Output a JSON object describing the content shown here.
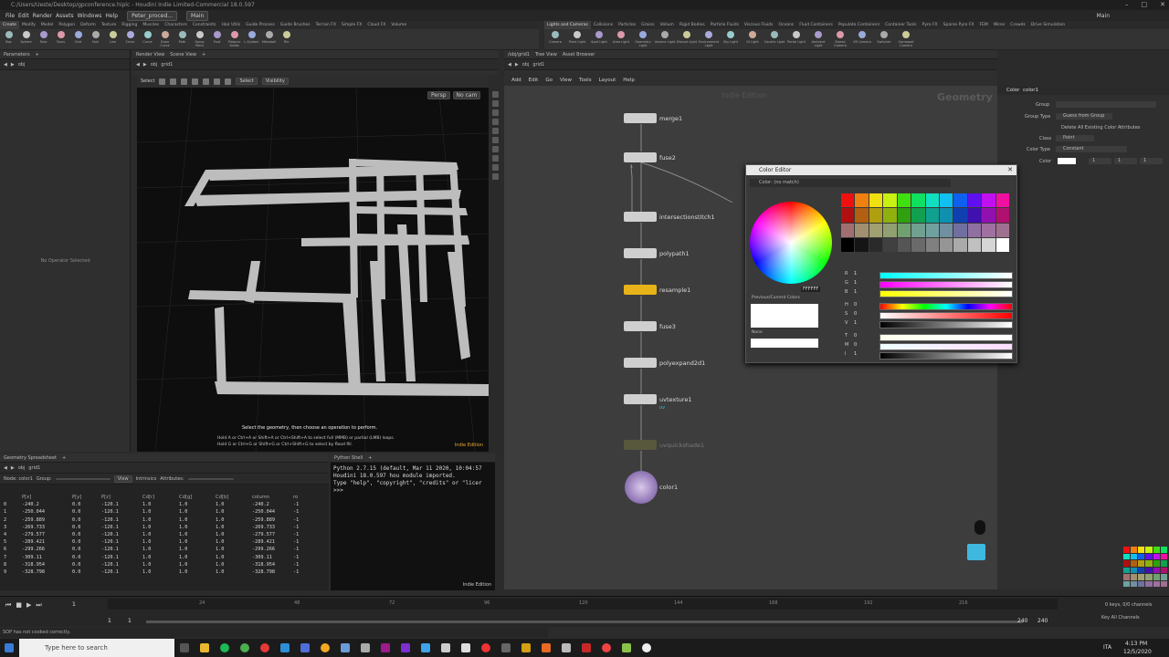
{
  "window": {
    "title": "C:/Users/Ueste/Desktop/gpconference.hiplc - Houdini Indie Limited-Commercial 18.0.597",
    "menus": [
      "File",
      "Edit",
      "Render",
      "Assets",
      "Windows",
      "Help"
    ],
    "desk": "Peter_proced...",
    "desk_main": "Main",
    "right_desk": "Main"
  },
  "shelf_left": {
    "tabs": [
      "Create",
      "Modify",
      "Model",
      "Polygon",
      "Deform",
      "Texture",
      "Rigging",
      "Muscles",
      "Characters",
      "Constraints",
      "Hair Utils",
      "Guide Process",
      "Guide Brushes",
      "Terrain FX",
      "Simple FX",
      "Cloud FX",
      "Volume"
    ],
    "tools": [
      "Box",
      "Sphere",
      "Tube",
      "Torus",
      "Grid",
      "Null",
      "Line",
      "Circle",
      "Curve",
      "Draw Curve",
      "Path",
      "Spray Paint",
      "Font",
      "Platonic Solids",
      "L-System",
      "Metaball",
      "File"
    ]
  },
  "shelf_right": {
    "tabs": [
      "Lights and Cameras",
      "Collisions",
      "Particles",
      "Grains",
      "Vellum",
      "Rigid Bodies",
      "Particle Fluids",
      "Viscous Fluids",
      "Oceans",
      "Fluid Containers",
      "Populate Containers",
      "Container Tools",
      "Pyro FX",
      "Sparse Pyro FX",
      "FEM",
      "Wires",
      "Crowds",
      "Drive Simulation"
    ],
    "tools": [
      "Camera",
      "Point Light",
      "Spot Light",
      "Area Light",
      "Geometry Light",
      "Volume Light",
      "Distant Light",
      "Environment Light",
      "Sky Light",
      "GI Light",
      "Caustic Light",
      "Portal Light",
      "Ambient Light",
      "Stereo Camera",
      "VR Camera",
      "Switcher",
      "Gamepad Camera"
    ]
  },
  "params_left": {
    "tab": "Parameters",
    "path": "obj",
    "empty_text": "No Operator Selected"
  },
  "viewport": {
    "tabs": [
      "Render View",
      "Scene View"
    ],
    "path": [
      "obj",
      "grid1"
    ],
    "select_label": "Select",
    "select_mode": "Select",
    "visibility": "Visibility",
    "persp": "Persp",
    "cam": "No cam",
    "hint_main": "Select the geometry, then choose an operation to perform.",
    "hint_line1": "Hold A or Ctrl+A or Shift+A or Ctrl+Shift+A to select full (MMB) or partial (LMB) loops.",
    "hint_line2": "Hold G or Ctrl+G or Shift+G or Ctrl+Shift+G to select by flood fill.",
    "edition": "Indie Edition"
  },
  "network": {
    "path_tab": "/obj/grid1",
    "tabs": [
      "Tree View",
      "Asset Browser"
    ],
    "path": [
      "obj",
      "grid1"
    ],
    "menus": [
      "Add",
      "Edit",
      "Go",
      "View",
      "Tools",
      "Layout",
      "Help"
    ],
    "watermark": "Indie Edition",
    "context": "Geometry",
    "nodes": [
      {
        "name": "merge1",
        "flag": ""
      },
      {
        "name": "fuse2",
        "flag": ""
      },
      {
        "name": "intersectionstitch1",
        "flag": ""
      },
      {
        "name": "polypath1",
        "flag": ""
      },
      {
        "name": "resample1",
        "flag": ""
      },
      {
        "name": "fuse3",
        "flag": ""
      },
      {
        "name": "polyexpand2d1",
        "flag": ""
      },
      {
        "name": "uvtexture1",
        "flag": "uv"
      },
      {
        "name": "uvquickshade1",
        "flag": ""
      },
      {
        "name": "color1",
        "flag": ""
      }
    ]
  },
  "color_params": {
    "node_type": "Color",
    "node_name": "color1",
    "labels": {
      "group": "Group",
      "group_type": "Group Type",
      "group_type_val": "Guess from Group",
      "delete_attr": "Delete All Existing Color Attributes",
      "class": "Class",
      "class_val": "Point",
      "color_type": "Color Type",
      "color_type_val": "Constant",
      "color": "Color",
      "c1": "1",
      "c2": "1",
      "c3": "1"
    }
  },
  "color_editor": {
    "title": "Color Editor",
    "match": "Color: (no match)",
    "hex": "FFFFFF",
    "prev_current": "Previous/Current Colors",
    "none": "None",
    "channels": [
      {
        "l": "R",
        "v": "1"
      },
      {
        "l": "G",
        "v": "1"
      },
      {
        "l": "B",
        "v": "1"
      },
      {
        "l": "H",
        "v": "0"
      },
      {
        "l": "S",
        "v": "0"
      },
      {
        "l": "V",
        "v": "1"
      },
      {
        "l": "T",
        "v": "0"
      },
      {
        "l": "M",
        "v": "0"
      },
      {
        "l": "I",
        "v": "1"
      }
    ],
    "swatches": [
      "#f01010",
      "#f08010",
      "#f0e010",
      "#c8f010",
      "#40e010",
      "#10e060",
      "#10e0c0",
      "#10c0f0",
      "#1060f0",
      "#6010f0",
      "#c010f0",
      "#f010a0",
      "#b01010",
      "#b06010",
      "#b0a010",
      "#90b010",
      "#30a010",
      "#10a050",
      "#10a090",
      "#1090b0",
      "#1040b0",
      "#4010b0",
      "#9010b0",
      "#b01070",
      "#a07070",
      "#a09070",
      "#a0a070",
      "#90a070",
      "#70a070",
      "#70a090",
      "#70a0a0",
      "#7090a0",
      "#7070a0",
      "#9070a0",
      "#a070a0",
      "#a07090",
      "#000000",
      "#151515",
      "#2a2a2a",
      "#404040",
      "#555555",
      "#6a6a6a",
      "#808080",
      "#959595",
      "#aaaaaa",
      "#c0c0c0",
      "#d5d5d5",
      "#ffffff"
    ]
  },
  "spreadsheet": {
    "tab": "Geometry Spreadsheet",
    "path": [
      "obj",
      "grid1"
    ],
    "group_label": "Group:",
    "view": "View",
    "intrinsics": "Intrinsics",
    "attributes": "Attributes:",
    "node": "Node: color1",
    "headers": [
      "",
      "P[x]",
      "P[y]",
      "P[z]",
      "Cd[r]",
      "Cd[g]",
      "Cd[b]",
      "column",
      "ro"
    ],
    "rows": [
      [
        "0",
        "-240.2",
        "0.0",
        "-120.1",
        "1.0",
        "1.0",
        "1.0",
        "-240.2",
        "-1"
      ],
      [
        "1",
        "-250.044",
        "0.0",
        "-120.1",
        "1.0",
        "1.0",
        "1.0",
        "-250.044",
        "-1"
      ],
      [
        "2",
        "-259.889",
        "0.0",
        "-120.1",
        "1.0",
        "1.0",
        "1.0",
        "-259.889",
        "-1"
      ],
      [
        "3",
        "-269.733",
        "0.0",
        "-120.1",
        "1.0",
        "1.0",
        "1.0",
        "-269.733",
        "-1"
      ],
      [
        "4",
        "-279.577",
        "0.0",
        "-120.1",
        "1.0",
        "1.0",
        "1.0",
        "-279.577",
        "-1"
      ],
      [
        "5",
        "-289.421",
        "0.0",
        "-120.1",
        "1.0",
        "1.0",
        "1.0",
        "-289.421",
        "-1"
      ],
      [
        "6",
        "-299.266",
        "0.0",
        "-120.1",
        "1.0",
        "1.0",
        "1.0",
        "-299.266",
        "-1"
      ],
      [
        "7",
        "-309.11",
        "0.0",
        "-120.1",
        "1.0",
        "1.0",
        "1.0",
        "-309.11",
        "-1"
      ],
      [
        "8",
        "-318.954",
        "0.0",
        "-120.1",
        "1.0",
        "1.0",
        "1.0",
        "-318.954",
        "-1"
      ],
      [
        "9",
        "-328.798",
        "0.0",
        "-120.1",
        "1.0",
        "1.0",
        "1.0",
        "-328.798",
        "-1"
      ]
    ]
  },
  "python": {
    "tab": "Python Shell",
    "lines": [
      "Python 2.7.15 (default, Mar 11 2020, 10:04:57",
      "Houdini 18.0.597 hou module imported.",
      "Type \"help\", \"copyright\", \"credits\" or \"licer",
      ">>>"
    ],
    "edition": "Indie Edition"
  },
  "timeline": {
    "frame": "1",
    "start": "1",
    "start2": "1",
    "end": "240",
    "end2": "240",
    "ticks": [
      "24",
      "48",
      "72",
      "96",
      "120",
      "144",
      "168",
      "192",
      "216"
    ],
    "keys": "0 keys, 0/0 channels",
    "key_all": "Key All Channels"
  },
  "status": "SOP has not cooked correctly.",
  "taskbar": {
    "search": "Type here to search",
    "time": "4:13 PM",
    "date": "12/5/2020",
    "lang": "ITA"
  }
}
